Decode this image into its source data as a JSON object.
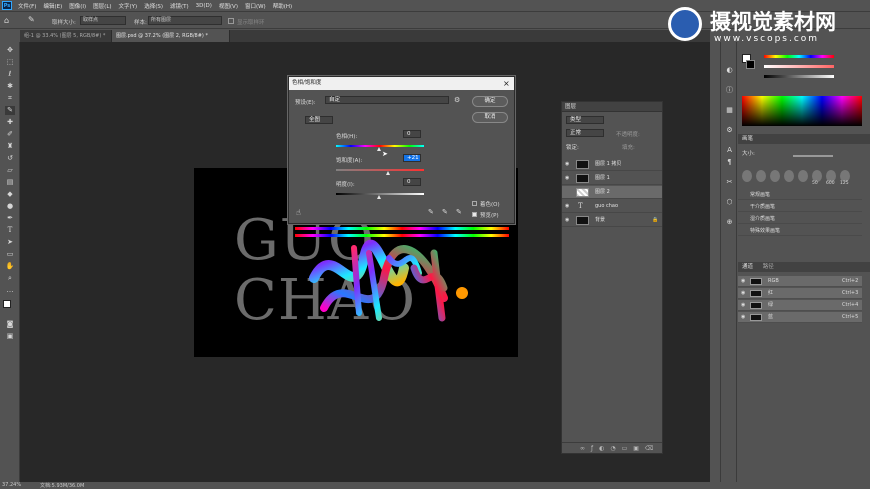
{
  "menu": {
    "logo": "Ps",
    "items": [
      "文件(F)",
      "编辑(E)",
      "图像(I)",
      "图层(L)",
      "文字(Y)",
      "选择(S)",
      "滤镜(T)",
      "3D(D)",
      "视图(V)",
      "窗口(W)",
      "帮助(H)"
    ]
  },
  "options": {
    "sample_size_label": "取样大小:",
    "sample_size_value": "取样点",
    "sample_label": "样本:",
    "sample_value": "所有图层",
    "ring_label": "显示取样环"
  },
  "tabs": [
    {
      "label": "组-1 @ 33.4% (图层 5, RGB/8#) *"
    },
    {
      "label": "图层.psd @ 37.2% (图层 2, RGB/8#) *"
    }
  ],
  "canvas": {
    "text_line1": "GUO",
    "text_line2": "CHAO"
  },
  "dialog": {
    "title": "色相/饱和度",
    "close": "×",
    "preset_label": "预设(E):",
    "preset_value": "自定",
    "channel_value": "全图",
    "hue_label": "色相(H):",
    "hue_value": "0",
    "saturation_label": "饱和度(A):",
    "saturation_value": "+21",
    "lightness_label": "明度(I):",
    "lightness_value": "0",
    "ok": "确定",
    "cancel": "取消",
    "colorize": "着色(O)",
    "preview": "预览(P)"
  },
  "layers": {
    "title": "图层",
    "kind_label": "类型",
    "blend": "正常",
    "opacity_label": "不透明度:",
    "lock_label": "锁定:",
    "fill_label": "填充:",
    "rows": [
      {
        "name": "图层 1 拷贝"
      },
      {
        "name": "图层 1"
      },
      {
        "name": "图层 2"
      },
      {
        "name": "guo chao"
      },
      {
        "name": "背景"
      }
    ]
  },
  "brushes": {
    "title": "画笔",
    "size_label": "大小:",
    "sizes": [
      "",
      "",
      "",
      "",
      "",
      "50",
      "600",
      "125"
    ],
    "folders": [
      "常规画笔",
      "干介质画笔",
      "湿介质画笔",
      "特殊效果画笔"
    ]
  },
  "channels": {
    "tab1": "通道",
    "tab2": "路径",
    "rows": [
      {
        "name": "RGB",
        "shortcut": "Ctrl+2"
      },
      {
        "name": "红",
        "shortcut": "Ctrl+3"
      },
      {
        "name": "绿",
        "shortcut": "Ctrl+4"
      },
      {
        "name": "蓝",
        "shortcut": "Ctrl+5"
      }
    ]
  },
  "status": {
    "zoom": "37.24%",
    "doc": "文档:5.93M/36.0M"
  },
  "watermark": {
    "title": "摄视觉素材网",
    "url": "www.vscops.com"
  },
  "colors": {
    "accent": "#31a8ff",
    "dialog_title_bg": "#f0f0f0"
  }
}
